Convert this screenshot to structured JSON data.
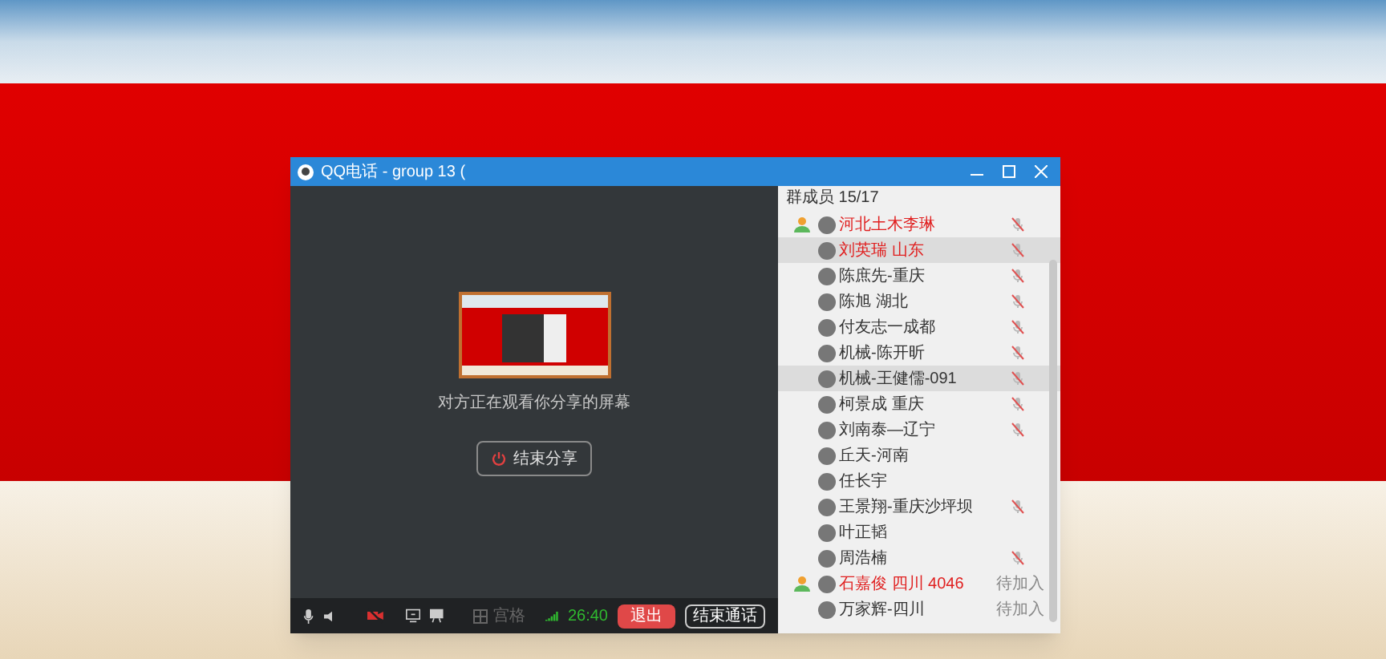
{
  "window": {
    "title": "QQ电话 - group 13 ("
  },
  "share": {
    "message": "对方正在观看你分享的屏幕",
    "stop_button": "结束分享"
  },
  "toolbar": {
    "camera_on": false,
    "grid_label": "宫格",
    "grid_disabled": true,
    "timer": "26:40",
    "exit_button": "退出",
    "end_call_button": "结束通话"
  },
  "members_header": "群成员 15/17",
  "members": [
    {
      "name": "河北土木李琳",
      "highlight": true,
      "admin": true,
      "muted": true,
      "selected": false
    },
    {
      "name": "刘英瑞 山东",
      "highlight": true,
      "admin": false,
      "muted": true,
      "selected": true
    },
    {
      "name": "陈庶先-重庆",
      "highlight": false,
      "admin": false,
      "muted": true,
      "selected": false
    },
    {
      "name": "陈旭 湖北",
      "highlight": false,
      "admin": false,
      "muted": true,
      "selected": false
    },
    {
      "name": "付友志一成都",
      "highlight": false,
      "admin": false,
      "muted": true,
      "selected": false
    },
    {
      "name": "机械-陈开昕",
      "highlight": false,
      "admin": false,
      "muted": true,
      "selected": false
    },
    {
      "name": "机械-王健儒-091",
      "highlight": false,
      "admin": false,
      "muted": true,
      "selected": true
    },
    {
      "name": "柯景成 重庆",
      "highlight": false,
      "admin": false,
      "muted": true,
      "selected": false
    },
    {
      "name": "刘南泰—辽宁",
      "highlight": false,
      "admin": false,
      "muted": true,
      "selected": false
    },
    {
      "name": "丘天-河南",
      "highlight": false,
      "admin": false,
      "muted": false,
      "selected": false
    },
    {
      "name": "任长宇",
      "highlight": false,
      "admin": false,
      "muted": false,
      "selected": false
    },
    {
      "name": "王景翔-重庆沙坪坝",
      "highlight": false,
      "admin": false,
      "muted": true,
      "selected": false
    },
    {
      "name": "叶正韬",
      "highlight": false,
      "admin": false,
      "muted": false,
      "selected": false
    },
    {
      "name": "周浩楠",
      "highlight": false,
      "admin": false,
      "muted": true,
      "selected": false
    },
    {
      "name": "石嘉俊 四川 4046",
      "highlight": true,
      "admin": true,
      "muted": false,
      "selected": false,
      "status": "待加入"
    },
    {
      "name": "万家辉-四川",
      "highlight": false,
      "admin": false,
      "muted": false,
      "selected": false,
      "status": "待加入"
    }
  ]
}
